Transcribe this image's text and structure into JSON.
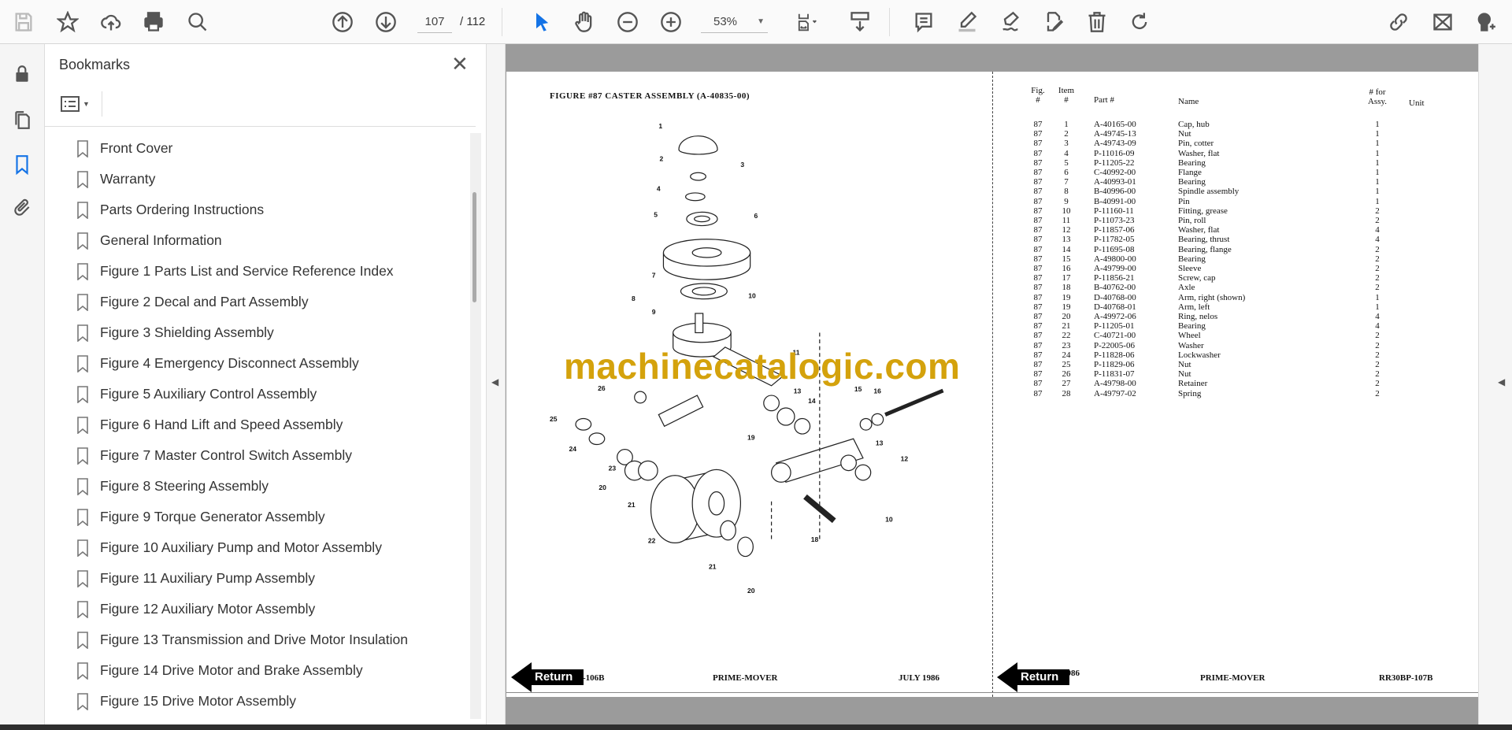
{
  "toolbar": {
    "current_page": "107",
    "total_pages": "/ 112",
    "zoom": "53%"
  },
  "bookmarks": {
    "title": "Bookmarks",
    "items": [
      "Front Cover",
      "Warranty",
      "Parts Ordering Instructions",
      "General Information",
      "Figure 1 Parts List and Service Reference Index",
      "Figure 2 Decal and Part Assembly",
      "Figure 3 Shielding Assembly",
      "Figure 4 Emergency Disconnect Assembly",
      "Figure 5 Auxiliary Control Assembly",
      "Figure 6 Hand Lift and Speed Assembly",
      "Figure 7 Master Control Switch Assembly",
      "Figure 8 Steering Assembly",
      "Figure 9 Torque Generator Assembly",
      "Figure 10 Auxiliary Pump and Motor Assembly",
      "Figure 11 Auxiliary Pump Assembly",
      "Figure 12 Auxiliary Motor Assembly",
      "Figure 13 Transmission and Drive Motor Insulation",
      "Figure 14 Drive Motor and Brake Assembly",
      "Figure 15 Drive Motor Assembly"
    ]
  },
  "document": {
    "figure_title": "FIGURE #87 CASTER ASSEMBLY (A-40835-00)",
    "watermark": "machinecatalogic.com",
    "callouts": [
      "1",
      "2",
      "3",
      "4",
      "5",
      "6",
      "7",
      "8",
      "9",
      "10",
      "11",
      "13",
      "14",
      "15",
      "16",
      "26",
      "25",
      "24",
      "23",
      "20",
      "21",
      "22",
      "19",
      "13",
      "12",
      "18",
      "10",
      "21",
      "20"
    ],
    "table_headers": {
      "fig": "Fig.",
      "fig2": "#",
      "item": "Item",
      "item2": "#",
      "part": "Part #",
      "name": "Name",
      "qty": "# for",
      "qty2": "Assy.",
      "unit": "Unit"
    },
    "parts": [
      [
        "87",
        "1",
        "A-40165-00",
        "Cap, hub",
        "1"
      ],
      [
        "87",
        "2",
        "A-49745-13",
        "Nut",
        "1"
      ],
      [
        "87",
        "3",
        "A-49743-09",
        "Pin, cotter",
        "1"
      ],
      [
        "87",
        "4",
        "P-11016-09",
        "Washer, flat",
        "1"
      ],
      [
        "87",
        "5",
        "P-11205-22",
        "Bearing",
        "1"
      ],
      [
        "87",
        "6",
        "C-40992-00",
        "Flange",
        "1"
      ],
      [
        "87",
        "7",
        "A-40993-01",
        "Bearing",
        "1"
      ],
      [
        "87",
        "8",
        "B-40996-00",
        "Spindle assembly",
        "1"
      ],
      [
        "87",
        "9",
        "B-40991-00",
        "Pin",
        "1"
      ],
      [
        "87",
        "10",
        "P-11160-11",
        "Fitting, grease",
        "2"
      ],
      [
        "87",
        "11",
        "P-11073-23",
        "Pin, roll",
        "2"
      ],
      [
        "87",
        "12",
        "P-11857-06",
        "Washer, flat",
        "4"
      ],
      [
        "87",
        "13",
        "P-11782-05",
        "Bearing, thrust",
        "4"
      ],
      [
        "87",
        "14",
        "P-11695-08",
        "Bearing, flange",
        "2"
      ],
      [
        "87",
        "15",
        "A-49800-00",
        "Bearing",
        "2"
      ],
      [
        "87",
        "16",
        "A-49799-00",
        "Sleeve",
        "2"
      ],
      [
        "87",
        "17",
        "P-11856-21",
        "Screw, cap",
        "2"
      ],
      [
        "87",
        "18",
        "B-40762-00",
        "Axle",
        "2"
      ],
      [
        "87",
        "19",
        "D-40768-00",
        "Arm, right (shown)",
        "1"
      ],
      [
        "87",
        "19",
        "D-40768-01",
        "Arm, left",
        "1"
      ],
      [
        "87",
        "20",
        "A-49972-06",
        "Ring, nelos",
        "4"
      ],
      [
        "87",
        "21",
        "P-11205-01",
        "Bearing",
        "4"
      ],
      [
        "87",
        "22",
        "C-40721-00",
        "Wheel",
        "2"
      ],
      [
        "87",
        "23",
        "P-22005-06",
        "Washer",
        "2"
      ],
      [
        "87",
        "24",
        "P-11828-06",
        "Lockwasher",
        "2"
      ],
      [
        "87",
        "25",
        "P-11829-06",
        "Nut",
        "2"
      ],
      [
        "87",
        "26",
        "P-11831-07",
        "Nut",
        "2"
      ],
      [
        "87",
        "27",
        "A-49798-00",
        "Retainer",
        "2"
      ],
      [
        "87",
        "28",
        "A-49797-02",
        "Spring",
        "2"
      ]
    ],
    "left_footer": {
      "code": "-106B",
      "title": "PRIME-MOVER",
      "date": "JULY 1986"
    },
    "right_footer": {
      "date": "JULY 1986",
      "title": "PRIME-MOVER",
      "code": "RR30BP-107B"
    },
    "return_label": "Return"
  },
  "colors": {
    "accent": "#1473e6",
    "watermark": "#d4a20c"
  }
}
